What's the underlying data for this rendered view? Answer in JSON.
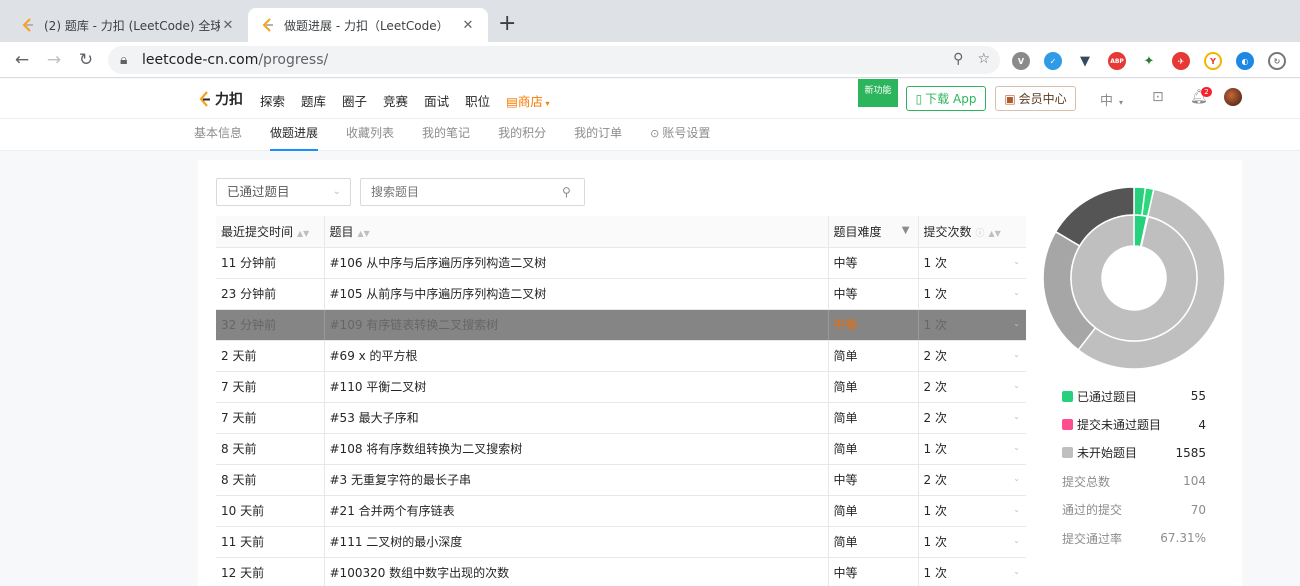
{
  "browser": {
    "tabs": [
      {
        "title": "(2) 题库 - 力扣 (LeetCode) 全球",
        "active": false
      },
      {
        "title": "做题进展 - 力扣（LeetCode）",
        "active": true
      }
    ],
    "url_host": "leetcode-cn.com",
    "url_path": "/progress/",
    "extensions": [
      "vee-extension-icon",
      "translate-extension-icon",
      "vue-devtools-icon",
      "adblock-icon",
      "ginkgo-extension-icon",
      "red-extension-icon",
      "yoyo-extension-icon",
      "globe-extension-icon",
      "loader-extension-icon"
    ]
  },
  "header": {
    "logo_text": "力扣",
    "nav": [
      "探索",
      "题库",
      "圈子",
      "竞赛",
      "面试",
      "职位"
    ],
    "shop_label": "商店",
    "new_feature": "新功能",
    "download_app": "下载 App",
    "vip_center": "会员中心",
    "lang": "中",
    "notification_count": "2"
  },
  "subnav": {
    "items": [
      "基本信息",
      "做题进展",
      "收藏列表",
      "我的笔记",
      "我的积分",
      "我的订单",
      "账号设置"
    ],
    "active": "做题进展"
  },
  "filter": {
    "status_value": "已通过题目",
    "search_placeholder": "搜索题目"
  },
  "table": {
    "columns": [
      "最近提交时间",
      "题目",
      "题目难度",
      "提交次数"
    ],
    "rows": [
      {
        "time": "11 分钟前",
        "title": "#106 从中序与后序遍历序列构造二叉树",
        "difficulty": "中等",
        "level": "medium",
        "count": "1 次"
      },
      {
        "time": "23 分钟前",
        "title": "#105 从前序与中序遍历序列构造二叉树",
        "difficulty": "中等",
        "level": "medium",
        "count": "1 次"
      },
      {
        "time": "32 分钟前",
        "title": "#109 有序链表转换二叉搜索树",
        "difficulty": "中等",
        "level": "medium",
        "count": "1 次",
        "selected": true
      },
      {
        "time": "2 天前",
        "title": "#69 x 的平方根",
        "difficulty": "简单",
        "level": "easy",
        "count": "2 次"
      },
      {
        "time": "7 天前",
        "title": "#110 平衡二叉树",
        "difficulty": "简单",
        "level": "easy",
        "count": "2 次"
      },
      {
        "time": "7 天前",
        "title": "#53 最大子序和",
        "difficulty": "简单",
        "level": "easy",
        "count": "2 次"
      },
      {
        "time": "8 天前",
        "title": "#108 将有序数组转换为二叉搜索树",
        "difficulty": "简单",
        "level": "easy",
        "count": "1 次"
      },
      {
        "time": "8 天前",
        "title": "#3 无重复字符的最长子串",
        "difficulty": "中等",
        "level": "medium",
        "count": "2 次"
      },
      {
        "time": "10 天前",
        "title": "#21 合并两个有序链表",
        "difficulty": "简单",
        "level": "easy",
        "count": "1 次"
      },
      {
        "time": "11 天前",
        "title": "#111 二叉树的最小深度",
        "difficulty": "简单",
        "level": "easy",
        "count": "1 次"
      },
      {
        "time": "12 天前",
        "title": "#100320 数组中数字出现的次数",
        "difficulty": "中等",
        "level": "medium",
        "count": "1 次"
      }
    ]
  },
  "stats": {
    "legend": [
      {
        "label": "已通过题目",
        "value": "55",
        "color": "#26d07c"
      },
      {
        "label": "提交未通过题目",
        "value": "4",
        "color": "#ff4d8d"
      },
      {
        "label": "未开始题目",
        "value": "1585",
        "color": "#bfbfbf"
      }
    ],
    "summary": [
      {
        "label": "提交总数",
        "value": "104"
      },
      {
        "label": "通过的提交",
        "value": "70"
      },
      {
        "label": "提交通过率",
        "value": "67.31%"
      }
    ]
  },
  "chart_data": {
    "type": "pie",
    "inner_ring": [
      {
        "label": "已通过题目",
        "value": 55,
        "color": "#26d07c"
      },
      {
        "label": "提交未通过题目",
        "value": 4,
        "color": "#ff4d8d"
      },
      {
        "label": "未开始题目",
        "value": 1585,
        "color": "#bfbfbf"
      }
    ],
    "outer_ring": [
      {
        "value": 2.0,
        "color": "#26d07c"
      },
      {
        "value": 1.5,
        "color": "#2bd97d"
      },
      {
        "value": 57.0,
        "color": "#bfbfbf"
      },
      {
        "value": 23.0,
        "color": "#a6a6a6"
      },
      {
        "value": 16.5,
        "color": "#555555"
      }
    ]
  }
}
